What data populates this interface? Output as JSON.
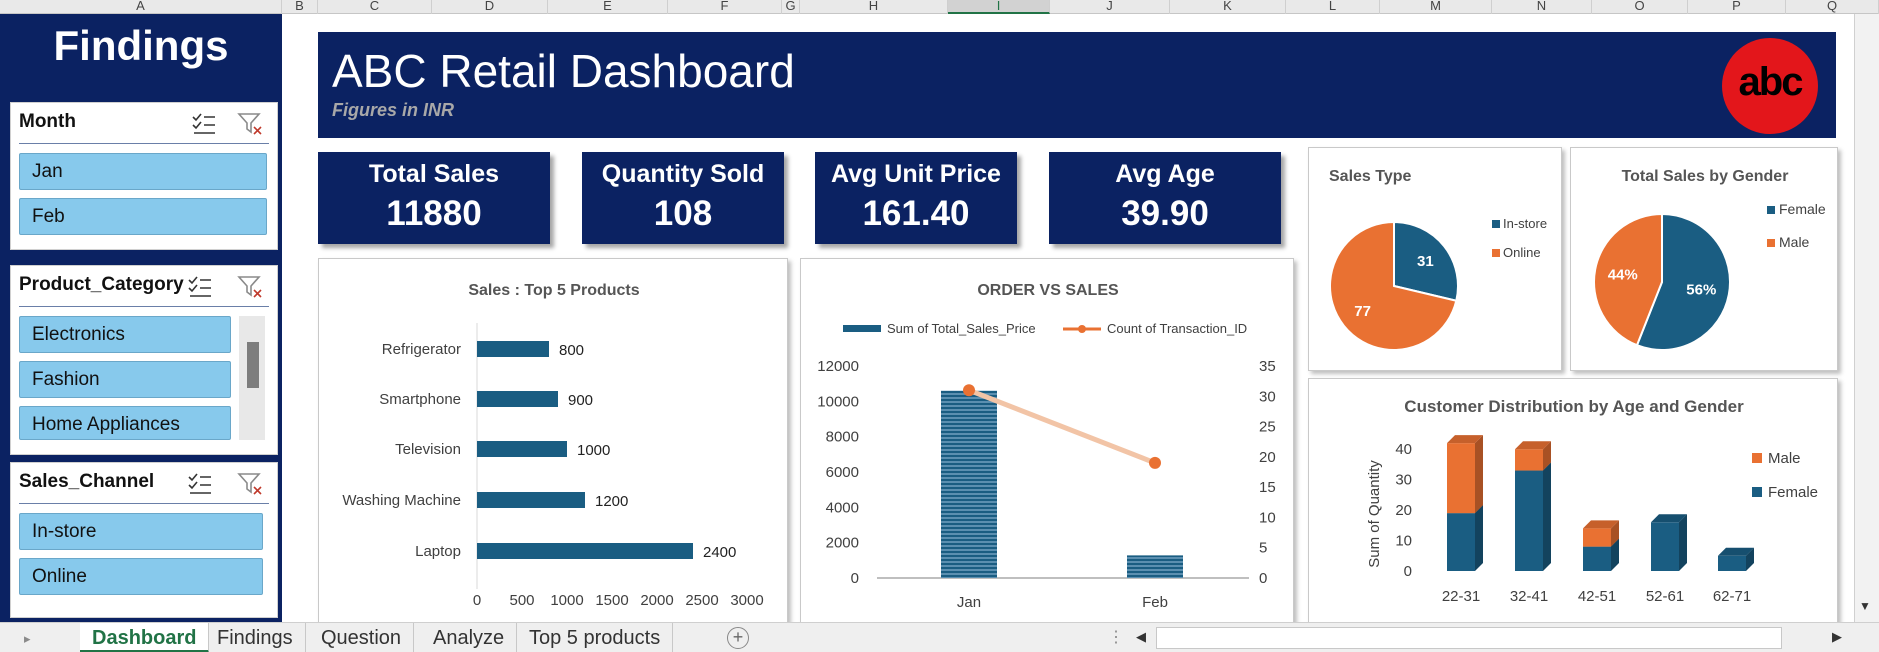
{
  "columns": [
    "A",
    "B",
    "C",
    "D",
    "E",
    "F",
    "G",
    "H",
    "I",
    "J",
    "K",
    "L",
    "M",
    "N",
    "O",
    "P",
    "Q"
  ],
  "selected_column": "I",
  "left_panel": {
    "title": "Findings",
    "slicers": [
      {
        "header": "Month",
        "items": [
          "Jan",
          "Feb"
        ]
      },
      {
        "header": "Product_Category",
        "items": [
          "Electronics",
          "Fashion",
          "Home Appliances"
        ]
      },
      {
        "header": "Sales_Channel",
        "items": [
          "In-store",
          "Online"
        ]
      }
    ]
  },
  "banner": {
    "title": "ABC Retail Dashboard",
    "subtitle": "Figures in INR",
    "logo_text": "abc"
  },
  "kpis": [
    {
      "label": "Total Sales",
      "value": "11880"
    },
    {
      "label": "Quantity Sold",
      "value": "108"
    },
    {
      "label": "Avg Unit Price",
      "value": "161.40"
    },
    {
      "label": "Avg Age",
      "value": "39.90"
    }
  ],
  "colors": {
    "navy": "#0b2262",
    "bar_blue": "#1a5d82",
    "orange": "#e97132",
    "slicer_item": "#87c9ec",
    "excel_green": "#217346"
  },
  "chart_data": [
    {
      "id": "top5",
      "type": "bar",
      "orientation": "horizontal",
      "title": "Sales : Top 5 Products",
      "categories": [
        "Refrigerator",
        "Smartphone",
        "Television",
        "Washing Machine",
        "Laptop"
      ],
      "values": [
        800,
        900,
        1000,
        1200,
        2400
      ],
      "xlim": [
        0,
        3000
      ],
      "xticks": [
        "0",
        "500",
        "1000",
        "1500",
        "2000",
        "2500",
        "3000"
      ]
    },
    {
      "id": "order_sales",
      "type": "bar",
      "title": "ORDER VS SALES",
      "categories": [
        "Jan",
        "Feb"
      ],
      "series": [
        {
          "name": "Sum of Total_Sales_Price",
          "type": "bar",
          "axis": "left",
          "values": [
            10600,
            1280
          ]
        },
        {
          "name": "Count of Transaction_ID",
          "type": "line",
          "axis": "right",
          "values": [
            31,
            19
          ]
        }
      ],
      "ylim": [
        0,
        12000
      ],
      "yticks": [
        "0",
        "2000",
        "4000",
        "6000",
        "8000",
        "10000",
        "12000"
      ],
      "y2lim": [
        0,
        35
      ],
      "y2ticks": [
        "0",
        "5",
        "10",
        "15",
        "20",
        "25",
        "30",
        "35"
      ]
    },
    {
      "id": "sales_type",
      "type": "pie",
      "title": "Sales Type",
      "labels": [
        "In-store",
        "Online"
      ],
      "values": [
        31,
        77
      ],
      "data_labels": [
        "31",
        "77"
      ]
    },
    {
      "id": "gender_sales",
      "type": "pie",
      "title": "Total Sales by Gender",
      "labels": [
        "Female",
        "Male"
      ],
      "values": [
        56,
        44
      ],
      "data_labels": [
        "56%",
        "44%"
      ]
    },
    {
      "id": "age_gender",
      "type": "bar",
      "stacked": true,
      "title": "Customer Distribution by Age and Gender",
      "ylabel": "Sum of Quantity",
      "categories": [
        "22-31",
        "32-41",
        "42-51",
        "52-61",
        "62-71"
      ],
      "series": [
        {
          "name": "Female",
          "values": [
            19,
            33,
            8,
            16,
            5
          ]
        },
        {
          "name": "Male",
          "values": [
            23,
            7,
            6,
            0,
            0
          ]
        }
      ],
      "ylim": [
        0,
        45
      ],
      "yticks": [
        "0",
        "10",
        "20",
        "30",
        "40"
      ],
      "legend_position": "right"
    }
  ],
  "tabs": [
    "Dashboard",
    "Findings",
    "Question",
    "Analyze",
    "Top 5 products"
  ],
  "active_tab": "Dashboard"
}
